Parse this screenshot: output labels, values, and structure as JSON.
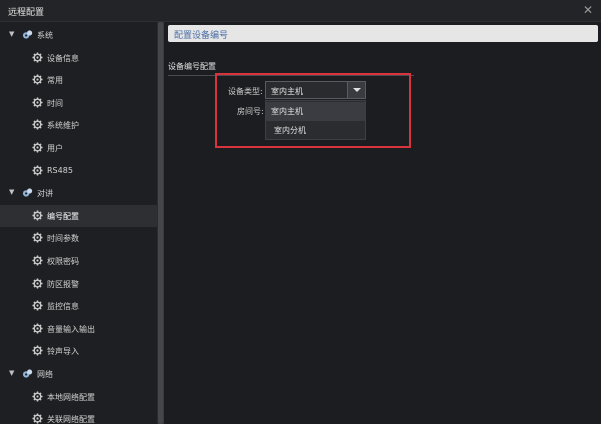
{
  "window": {
    "title": "远程配置",
    "close_glyph": "✕"
  },
  "sidebar": {
    "items": [
      {
        "label": "系统",
        "level": 0,
        "icon": "gear-group-icon",
        "expanded": true
      },
      {
        "label": "设备信息",
        "level": 1,
        "icon": "gear-icon"
      },
      {
        "label": "常用",
        "level": 1,
        "icon": "gear-icon"
      },
      {
        "label": "时间",
        "level": 1,
        "icon": "gear-icon"
      },
      {
        "label": "系统维护",
        "level": 1,
        "icon": "gear-icon"
      },
      {
        "label": "用户",
        "level": 1,
        "icon": "gear-icon"
      },
      {
        "label": "RS485",
        "level": 1,
        "icon": "gear-icon"
      },
      {
        "label": "对讲",
        "level": 0,
        "icon": "gear-group-icon",
        "expanded": true
      },
      {
        "label": "编号配置",
        "level": 1,
        "icon": "gear-icon",
        "selected": true
      },
      {
        "label": "时间参数",
        "level": 1,
        "icon": "gear-icon"
      },
      {
        "label": "权限密码",
        "level": 1,
        "icon": "gear-icon"
      },
      {
        "label": "防区报警",
        "level": 1,
        "icon": "gear-icon"
      },
      {
        "label": "监控信息",
        "level": 1,
        "icon": "gear-icon"
      },
      {
        "label": "音量输入输出",
        "level": 1,
        "icon": "gear-icon"
      },
      {
        "label": "铃声导入",
        "level": 1,
        "icon": "gear-icon"
      },
      {
        "label": "网络",
        "level": 0,
        "icon": "gear-group-icon",
        "expanded": true
      },
      {
        "label": "本地网络配置",
        "level": 1,
        "icon": "gear-icon"
      },
      {
        "label": "关联网络配置",
        "level": 1,
        "icon": "gear-icon"
      }
    ]
  },
  "main": {
    "header": "配置设备编号",
    "section_title": "设备编号配置",
    "device_type_label": "设备类型:",
    "room_no_label": "房间号:",
    "device_type_value": "室内主机",
    "device_type_options": [
      "室内主机",
      "室内分机"
    ],
    "highlighted_option": "室内主机"
  },
  "colors": {
    "accent_text": "#4a6fa5",
    "highlight_border": "#d9343d"
  }
}
